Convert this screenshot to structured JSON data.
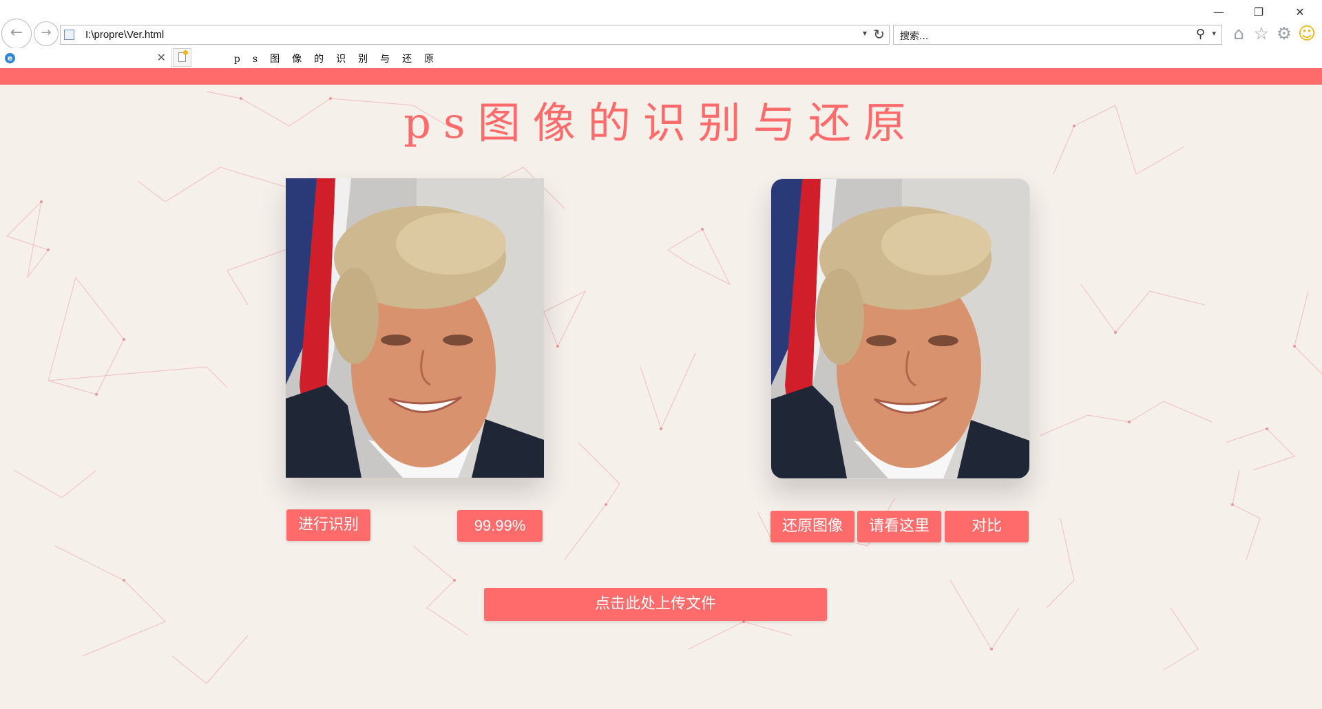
{
  "browser": {
    "url": "I:\\propre\\Ver.html",
    "search_placeholder": "搜索...",
    "tab_title": "ps图像的识别与还原",
    "minimize_glyph": "—",
    "restore_glyph": "❐",
    "close_glyph": "✕",
    "back_glyph": "←",
    "forward_glyph": "→",
    "refresh_glyph": "↻",
    "dropdown_glyph": "▾",
    "search_glyph": "⚲",
    "home_glyph": "⌂",
    "favorites_glyph": "☆",
    "tools_glyph": "⚙",
    "feedback_glyph": "☺",
    "tab_close_glyph": "✕",
    "icons": [
      "back-icon",
      "forward-icon",
      "refresh-icon",
      "search-icon",
      "home-icon",
      "favorites-icon",
      "gear-icon",
      "smiley-icon"
    ]
  },
  "page": {
    "title": "ps图像的识别与还原",
    "accent_color": "#ff6b6b",
    "background_color": "#f6f0eb",
    "identify_button": "进行识别",
    "score": "99.99%",
    "restore_button": "还原图像",
    "look_here_button": "请看这里",
    "compare_button": "对比",
    "upload_button": "点击此处上传文件"
  }
}
